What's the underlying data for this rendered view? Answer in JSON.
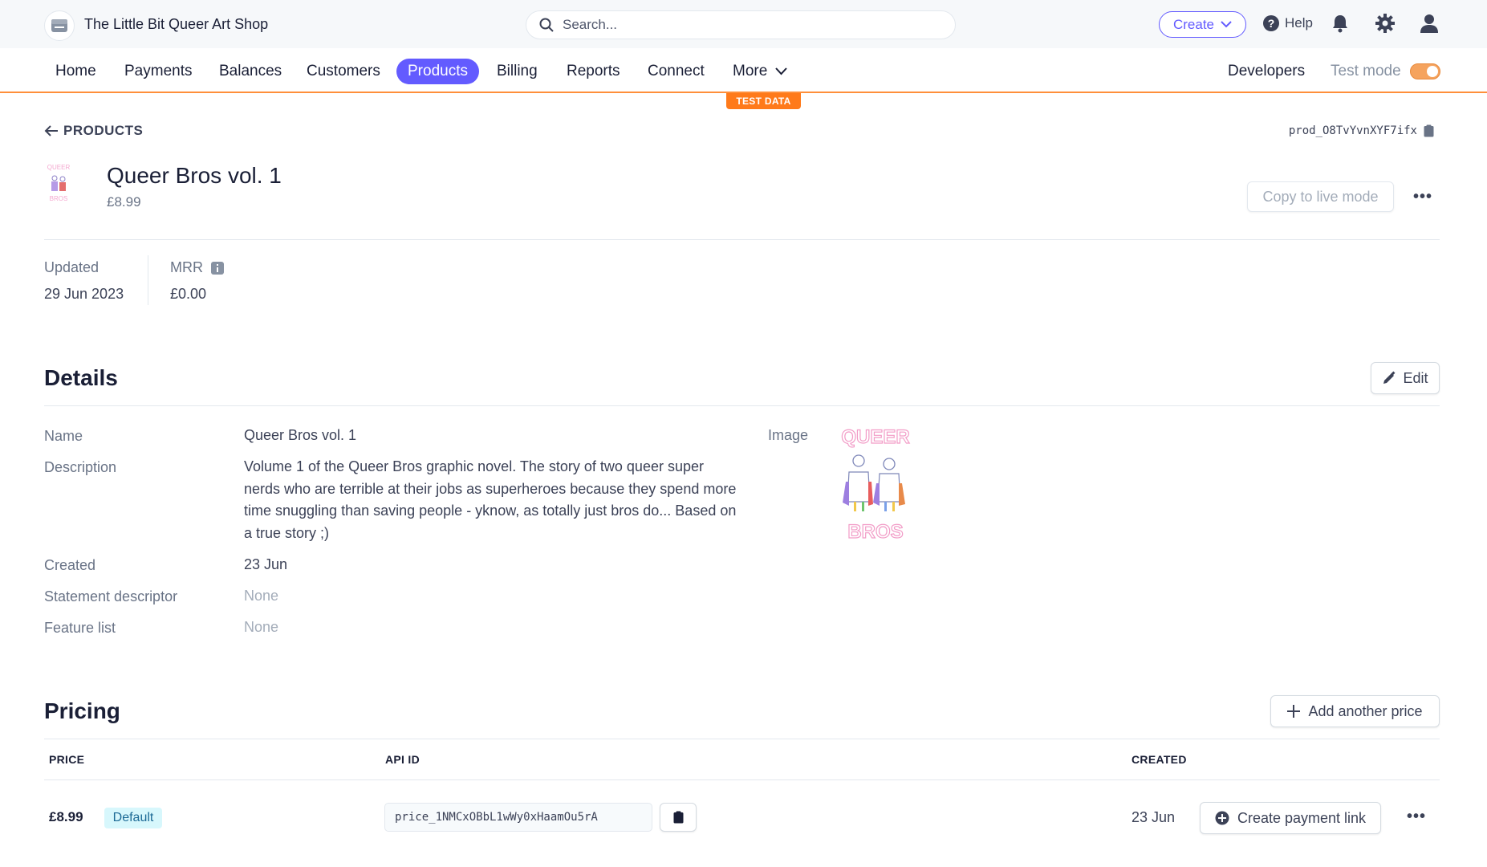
{
  "account": {
    "name": "The Little Bit Queer Art Shop"
  },
  "search": {
    "placeholder": "Search..."
  },
  "topbar": {
    "create_label": "Create",
    "help_label": "Help"
  },
  "nav": {
    "items": [
      {
        "label": "Home"
      },
      {
        "label": "Payments"
      },
      {
        "label": "Balances"
      },
      {
        "label": "Customers"
      },
      {
        "label": "Products",
        "active": true
      },
      {
        "label": "Billing"
      },
      {
        "label": "Reports"
      },
      {
        "label": "Connect"
      },
      {
        "label": "More"
      }
    ],
    "developers_label": "Developers",
    "test_mode_label": "Test mode",
    "test_mode_on": true,
    "test_data_badge": "TEST DATA"
  },
  "header": {
    "back_label": "PRODUCTS",
    "product_id": "prod_O8TvYvnXYF7ifx",
    "title": "Queer Bros vol. 1",
    "price": "£8.99",
    "copy_live_label": "Copy to live mode"
  },
  "stats": {
    "updated_label": "Updated",
    "updated_value": "29 Jun 2023",
    "mrr_label": "MRR",
    "mrr_value": "£0.00"
  },
  "details": {
    "title": "Details",
    "edit_label": "Edit",
    "name_label": "Name",
    "name_value": "Queer Bros vol. 1",
    "description_label": "Description",
    "description_value": "Volume 1 of the Queer Bros graphic novel. The story of two queer super nerds who are terrible at their jobs as superheroes because they spend more time snuggling than saving people - yknow, as totally just bros do... Based on a true story ;)",
    "created_label": "Created",
    "created_value": "23 Jun",
    "statement_label": "Statement descriptor",
    "statement_value": "None",
    "feature_label": "Feature list",
    "feature_value": "None",
    "image_label": "Image",
    "image_text_top": "QUEER",
    "image_text_bottom": "BROS"
  },
  "pricing": {
    "title": "Pricing",
    "add_price_label": "Add another price",
    "columns": {
      "price": "PRICE",
      "api_id": "API ID",
      "created": "CREATED"
    },
    "rows": [
      {
        "price": "£8.99",
        "badge": "Default",
        "api_id": "price_1NMCxOBbL1wWy0xHaamOu5rA",
        "created": "23 Jun",
        "payment_link_label": "Create payment link"
      }
    ]
  },
  "colors": {
    "brand": "#635bff",
    "test_mode_accent": "#ff7a1a"
  }
}
